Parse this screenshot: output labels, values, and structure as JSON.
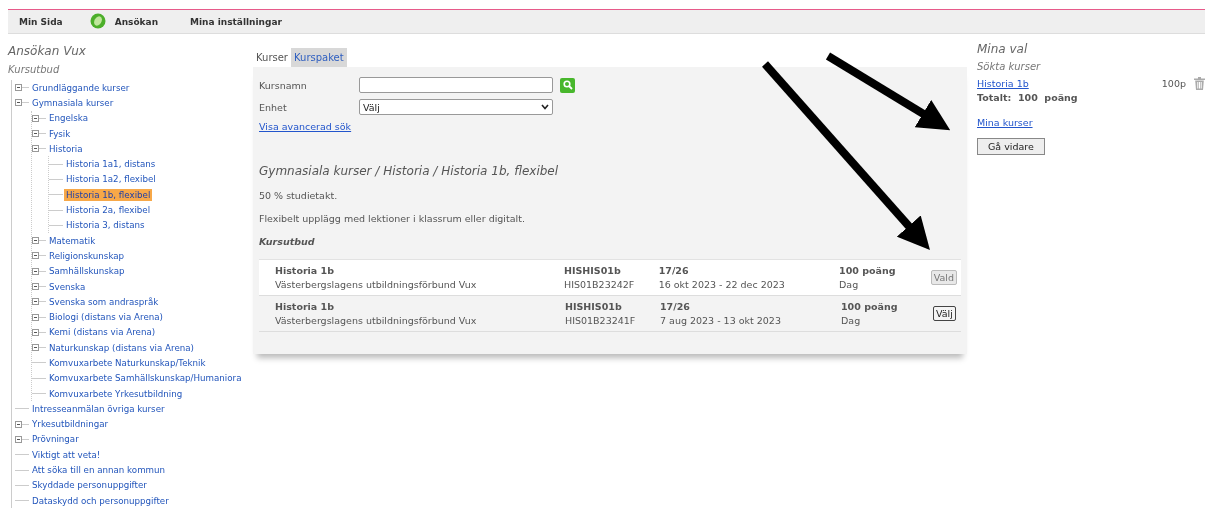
{
  "nav": [
    {
      "label": "Min Sida",
      "kind": "plain"
    },
    {
      "label": "Ansökan",
      "kind": "with-icon"
    },
    {
      "label": "Mina inställningar",
      "kind": "plain"
    }
  ],
  "sidebar": {
    "title": "Ansökan Vux",
    "subtitle": "Kursutbud",
    "tree": [
      {
        "label": "Grundläggande kurser",
        "kind": "folder",
        "selected": false
      },
      {
        "label": "Gymnasiala kurser",
        "kind": "folder",
        "selected": false,
        "children": [
          {
            "label": "Engelska",
            "kind": "folder",
            "selected": false
          },
          {
            "label": "Fysik",
            "kind": "folder",
            "selected": false
          },
          {
            "label": "Historia",
            "kind": "folder",
            "selected": false,
            "children": [
              {
                "label": "Historia 1a1, distans",
                "kind": "leaf",
                "selected": false
              },
              {
                "label": "Historia 1a2, flexibel",
                "kind": "leaf",
                "selected": false
              },
              {
                "label": "Historia 1b, flexibel",
                "kind": "leaf",
                "selected": true
              },
              {
                "label": "Historia 2a, flexibel",
                "kind": "leaf",
                "selected": false
              },
              {
                "label": "Historia 3, distans",
                "kind": "leaf",
                "selected": false
              }
            ]
          },
          {
            "label": "Matematik",
            "kind": "folder",
            "selected": false
          },
          {
            "label": "Religionskunskap",
            "kind": "folder",
            "selected": false
          },
          {
            "label": "Samhällskunskap",
            "kind": "folder",
            "selected": false
          },
          {
            "label": "Svenska",
            "kind": "folder",
            "selected": false
          },
          {
            "label": "Svenska som andraspråk",
            "kind": "folder",
            "selected": false
          },
          {
            "label": "Biologi (distans via Arena)",
            "kind": "folder",
            "selected": false
          },
          {
            "label": "Kemi (distans via Arena)",
            "kind": "folder",
            "selected": false
          },
          {
            "label": "Naturkunskap (distans via Arena)",
            "kind": "folder",
            "selected": false
          },
          {
            "label": "Komvuxarbete Naturkunskap/Teknik",
            "kind": "leaf",
            "selected": false
          },
          {
            "label": "Komvuxarbete Samhällskunskap/Humaniora",
            "kind": "leaf",
            "selected": false
          },
          {
            "label": "Komvuxarbete Yrkesutbildning",
            "kind": "leaf",
            "selected": false
          }
        ]
      },
      {
        "label": "Intresseanmälan övriga kurser",
        "kind": "leaf",
        "selected": false
      },
      {
        "label": "Yrkesutbildningar",
        "kind": "folder",
        "selected": false
      },
      {
        "label": "Prövningar",
        "kind": "folder",
        "selected": false
      },
      {
        "label": "Viktigt att veta!",
        "kind": "leaf",
        "selected": false
      },
      {
        "label": "Att söka till en annan kommun",
        "kind": "leaf",
        "selected": false
      },
      {
        "label": "Skyddade personuppgifter",
        "kind": "leaf",
        "selected": false
      },
      {
        "label": "Dataskydd och personuppgifter",
        "kind": "leaf",
        "selected": false
      }
    ]
  },
  "tabs": [
    {
      "label": "Kurser",
      "selected": true
    },
    {
      "label": "Kurspaket",
      "selected": false
    }
  ],
  "search": {
    "name_label": "Kursnamn",
    "unit_label": "Enhet",
    "unit_value": "Välj",
    "advanced_link": "Visa avancerad sök"
  },
  "course": {
    "breadcrumb": "Gymnasiala kurser / Historia / Historia 1b, flexibel",
    "pace": "50 % studietakt.",
    "description": "Flexibelt upplägg med lektioner i klassrum eller digitalt.",
    "offer_heading": "Kursutbud"
  },
  "offers": [
    {
      "name": "Historia 1b",
      "provider": "Västerbergslagens utbildningsförbund Vux",
      "code": "HISHIS01b",
      "id": "HIS01B23242F",
      "week": "17/26",
      "dates": "16 okt 2023 - 22 dec 2023",
      "points": "100 poäng",
      "time": "Dag",
      "button": "Vald",
      "selected": true
    },
    {
      "name": "Historia 1b",
      "provider": "Västerbergslagens utbildningsförbund Vux",
      "code": "HISHIS01b",
      "id": "HIS01B23241F",
      "week": "17/26",
      "dates": "7 aug 2023 - 13 okt 2023",
      "points": "100 poäng",
      "time": "Dag",
      "button": "Välj",
      "selected": false
    }
  ],
  "choices": {
    "title": "Mina val",
    "subtitle": "Sökta kurser",
    "items": [
      {
        "name": "Historia 1b",
        "points": "100p"
      }
    ],
    "total": "Totalt:  100  poäng",
    "link": "Mina kurser",
    "button": "Gå vidare"
  }
}
